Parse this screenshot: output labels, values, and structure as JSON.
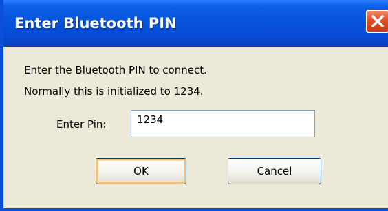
{
  "dialog": {
    "title": "Enter Bluetooth PIN",
    "message_line1": "Enter the Bluetooth PIN to connect.",
    "message_line2": "Normally this is initialized to 1234.",
    "pin_label": "Enter Pin:",
    "pin_value": "1234",
    "ok_label": "OK",
    "cancel_label": "Cancel"
  },
  "icons": {
    "close": "close-icon"
  },
  "colors": {
    "titlebar": "#0652db",
    "close_button": "#e0522c",
    "dialog_background": "#ece9d8",
    "default_button_highlight": "#f5c26b"
  }
}
